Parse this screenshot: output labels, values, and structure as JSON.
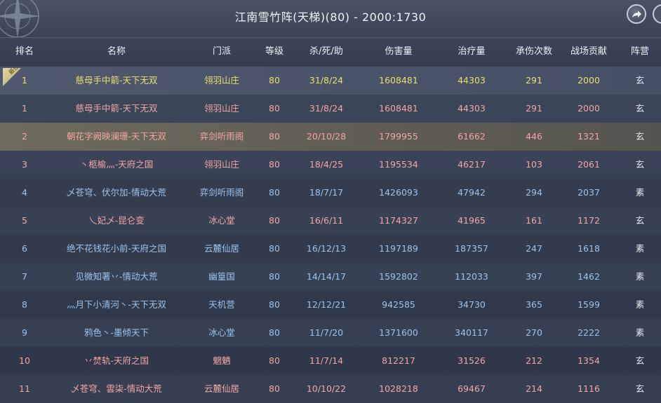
{
  "window": {
    "title": "江南雪竹阵(天梯)(80) - 2000:1730"
  },
  "icons": {
    "share": "share-arrow-icon",
    "compass": "compass-emblem-icon",
    "close": "close-tab-icon"
  },
  "colors": {
    "xuan_faction_text": "#f4a6a6",
    "su_faction_text": "#9cc3ee",
    "highlight_text": "#e9e06e",
    "self_row_bg": "#6e6b5e"
  },
  "table": {
    "headers": {
      "rank": "排名",
      "name": "名称",
      "school": "门派",
      "level": "等级",
      "kda": "杀/死/助",
      "damage": "伤害量",
      "heal": "治疗量",
      "hurt": "承伤次数",
      "contrib": "战场贡献",
      "camp": "阵营"
    },
    "top_ribbon_label": "最佳",
    "rows": [
      {
        "rank": "1",
        "name": "慈母手中箭-天下无双",
        "school": "翎羽山庄",
        "level": "80",
        "kda": "31/8/24",
        "damage": "1608481",
        "heal": "44303",
        "hurt": "291",
        "contrib": "2000",
        "camp": "玄"
      },
      {
        "rank": "1",
        "name": "慈母手中箭-天下无双",
        "school": "翎羽山庄",
        "level": "80",
        "kda": "31/8/24",
        "damage": "1608481",
        "heal": "44303",
        "hurt": "291",
        "contrib": "2000",
        "camp": "玄"
      },
      {
        "rank": "2",
        "name": "朝花字阙映澜珊-天下无双",
        "school": "弈剑听雨阁",
        "level": "80",
        "kda": "20/10/28",
        "damage": "1799955",
        "heal": "61662",
        "hurt": "446",
        "contrib": "1321",
        "camp": "玄"
      },
      {
        "rank": "3",
        "name": "丶柩榆灬-天府之国",
        "school": "翎羽山庄",
        "level": "80",
        "kda": "18/4/25",
        "damage": "1195534",
        "heal": "46217",
        "hurt": "103",
        "contrib": "2061",
        "camp": "玄"
      },
      {
        "rank": "4",
        "name": "乄苍穹、伏尔加-情动大荒",
        "school": "弈剑听雨阁",
        "level": "80",
        "kda": "18/7/17",
        "damage": "1426093",
        "heal": "47942",
        "hurt": "294",
        "contrib": "2037",
        "camp": "素"
      },
      {
        "rank": "5",
        "name": "乀妃乄-昆仑变",
        "school": "冰心堂",
        "level": "80",
        "kda": "16/6/11",
        "damage": "1174327",
        "heal": "41965",
        "hurt": "161",
        "contrib": "1172",
        "camp": "玄"
      },
      {
        "rank": "6",
        "name": "绝不花钱花小前-天府之国",
        "school": "云麓仙居",
        "level": "80",
        "kda": "16/12/13",
        "damage": "1197189",
        "heal": "187357",
        "hurt": "247",
        "contrib": "1618",
        "camp": "素"
      },
      {
        "rank": "7",
        "name": "见微知著丷-情动大荒",
        "school": "幽篁国",
        "level": "80",
        "kda": "14/14/17",
        "damage": "1592802",
        "heal": "112033",
        "hurt": "397",
        "contrib": "1462",
        "camp": "素"
      },
      {
        "rank": "8",
        "name": "灬月下小清河丶-天下无双",
        "school": "天机营",
        "level": "80",
        "kda": "12/12/21",
        "damage": "942585",
        "heal": "34730",
        "hurt": "365",
        "contrib": "1599",
        "camp": "素"
      },
      {
        "rank": "9",
        "name": "鸦色丶-墨倾天下",
        "school": "冰心堂",
        "level": "80",
        "kda": "11/7/20",
        "damage": "1371600",
        "heal": "340117",
        "hurt": "270",
        "contrib": "2222",
        "camp": "素"
      },
      {
        "rank": "10",
        "name": "丷焚轨-天府之国",
        "school": "魍魉",
        "level": "80",
        "kda": "11/7/14",
        "damage": "812217",
        "heal": "31526",
        "hurt": "212",
        "contrib": "1354",
        "camp": "玄"
      },
      {
        "rank": "11",
        "name": "乄苍穹、雲柒-情动大荒",
        "school": "云麓仙居",
        "level": "80",
        "kda": "10/10/22",
        "damage": "1028218",
        "heal": "69467",
        "hurt": "214",
        "contrib": "1116",
        "camp": "玄"
      }
    ]
  }
}
